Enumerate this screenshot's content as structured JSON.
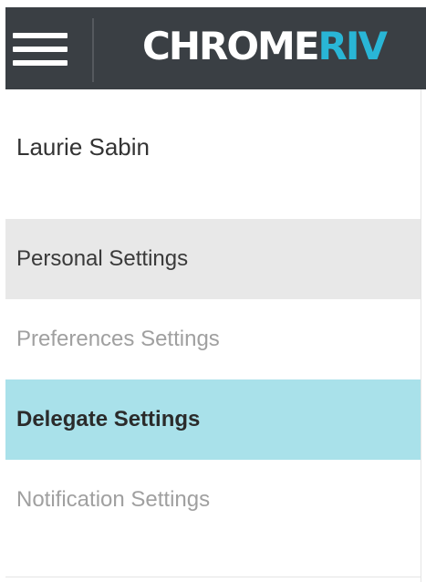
{
  "header": {
    "logo_main": "CHROME",
    "logo_accent": "RIV",
    "colors": {
      "background": "#3a3f44",
      "logo_accent": "#29b6d6"
    }
  },
  "user": {
    "name": "Laurie Sabin"
  },
  "menu": {
    "items": [
      {
        "label": "Personal Settings",
        "state": "hover"
      },
      {
        "label": "Preferences Settings",
        "state": "default"
      },
      {
        "label": "Delegate Settings",
        "state": "active"
      },
      {
        "label": "Notification Settings",
        "state": "default"
      }
    ],
    "colors": {
      "active_bg": "#a9e1ea",
      "hover_bg": "#e8e8e8"
    }
  }
}
